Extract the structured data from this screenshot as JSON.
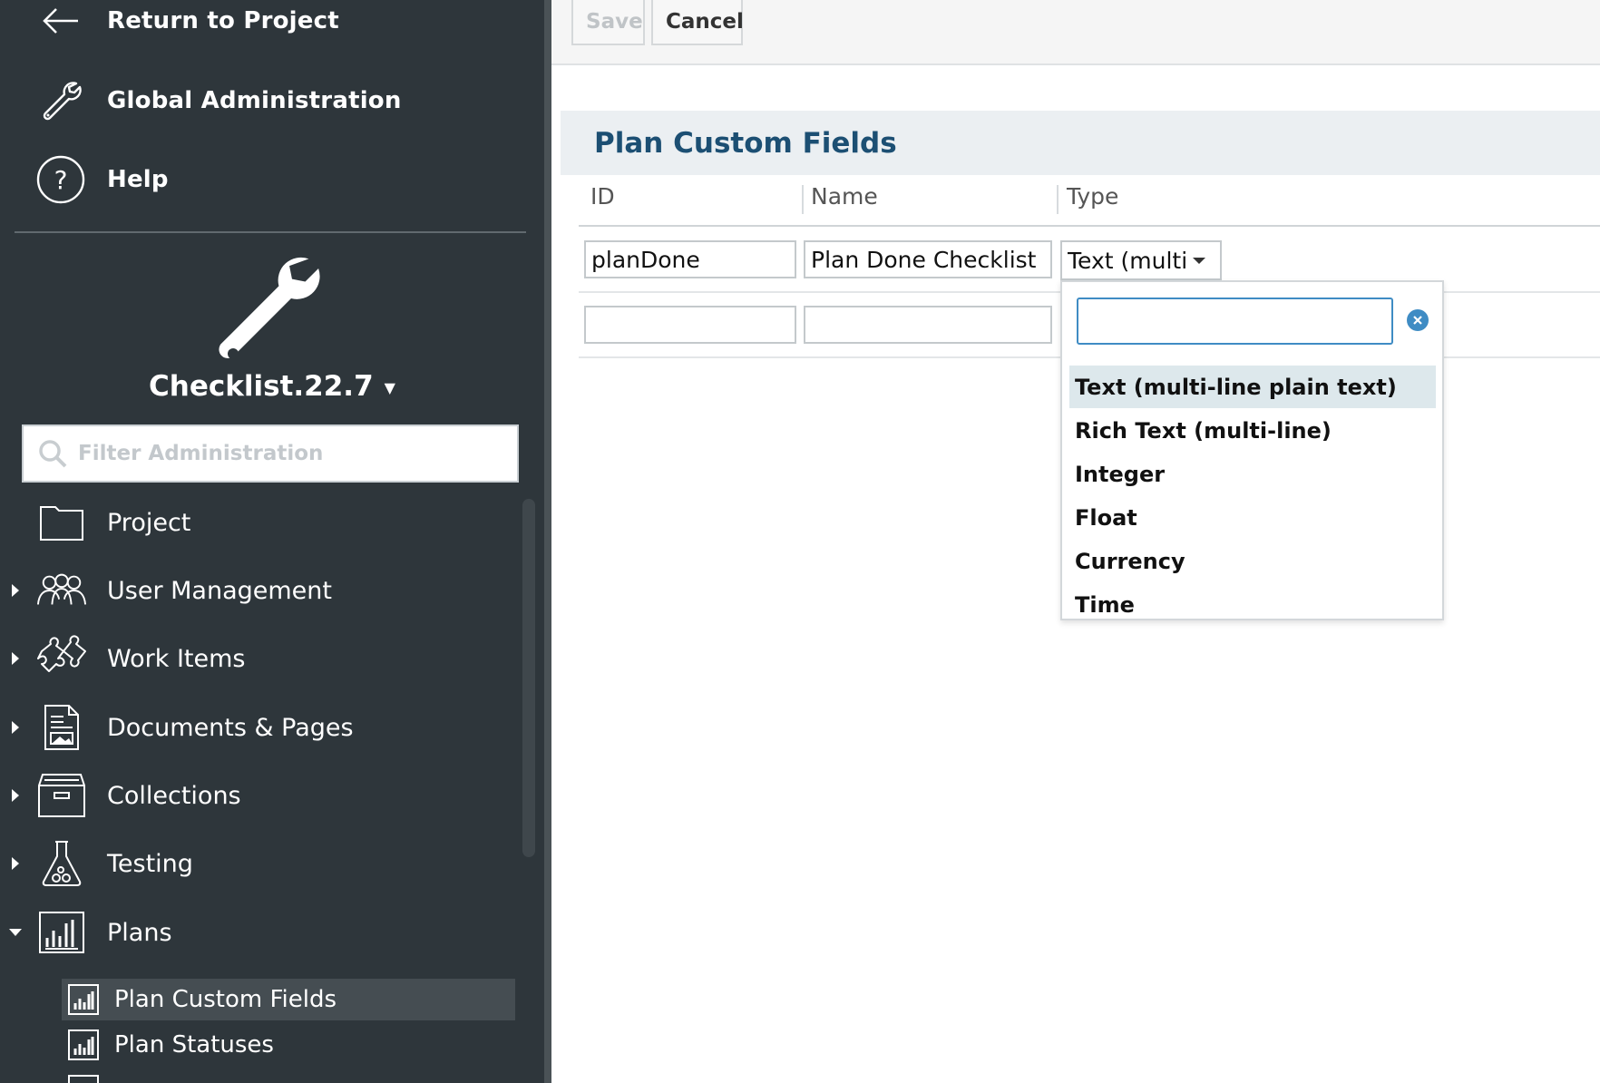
{
  "sidebar": {
    "top_links": [
      {
        "label": "Return to Project",
        "icon": "arrow-left-icon"
      },
      {
        "label": "Global Administration",
        "icon": "wrench-icon"
      },
      {
        "label": "Help",
        "icon": "help-circle-icon"
      }
    ],
    "project": {
      "name": "Checklist.22.7",
      "icon": "wrench-icon"
    },
    "filter": {
      "placeholder": "Filter Administration"
    },
    "nav_items": [
      {
        "label": "Project",
        "icon": "folder-icon",
        "expandable": false
      },
      {
        "label": "User Management",
        "icon": "users-icon",
        "expandable": true
      },
      {
        "label": "Work Items",
        "icon": "puzzle-icon",
        "expandable": true
      },
      {
        "label": "Documents & Pages",
        "icon": "document-icon",
        "expandable": true
      },
      {
        "label": "Collections",
        "icon": "archive-box-icon",
        "expandable": true
      },
      {
        "label": "Testing",
        "icon": "flask-icon",
        "expandable": true
      },
      {
        "label": "Plans",
        "icon": "bar-chart-icon",
        "expandable": true,
        "expanded": true
      }
    ],
    "sub_items": [
      {
        "label": "Plan Custom Fields",
        "icon": "bar-chart-icon",
        "active": true
      },
      {
        "label": "Plan Statuses",
        "icon": "bar-chart-icon",
        "active": false
      }
    ]
  },
  "toolbar": {
    "save_label": "Save",
    "cancel_label": "Cancel"
  },
  "panel": {
    "title": "Plan Custom Fields",
    "columns": [
      "ID",
      "Name",
      "Type"
    ],
    "rows": [
      {
        "id": "planDone",
        "name": "Plan Done Checklist",
        "type": "Text (multi"
      },
      {
        "id": "",
        "name": "",
        "type": ""
      }
    ]
  },
  "type_dropdown": {
    "search_value": "",
    "options": [
      "Text (multi-line plain text)",
      "Rich Text (multi-line)",
      "Integer",
      "Float",
      "Currency",
      "Time"
    ],
    "selected_index": 0
  },
  "colors": {
    "sidebar_bg": "#2e363b",
    "title_blue": "#1c4f73",
    "focus_blue": "#3f8cc4",
    "selected_bg": "#dde8ec"
  }
}
